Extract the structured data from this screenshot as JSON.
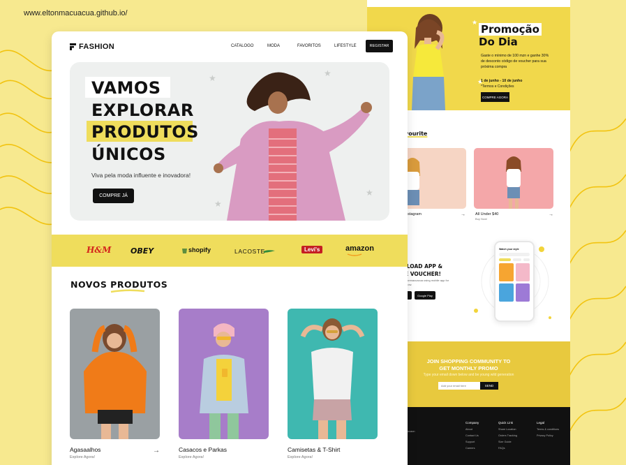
{
  "site_url": "www.eltonmacuacua.github.io/",
  "front": {
    "brand": "FASHION",
    "nav": {
      "catalogo": "CATALOGO",
      "moda": "MODA",
      "favoritos": "FAVORITOS",
      "lifestyle": "LIFESTYLE",
      "register": "REGISTAR"
    },
    "hero": {
      "line1": "VAMOS",
      "line2": "EXPLORAR",
      "line3": "PRODUTOS",
      "line4": "ÚNICOS",
      "subtitle": "Viva pela moda influente e inovadora!",
      "cta": "COMPRE JÁ"
    },
    "brands": [
      "H&M",
      "OBEY",
      "shopify",
      "LACOSTE",
      "Levi's",
      "amazon"
    ],
    "section_title": "NOVOS PRODUTOS",
    "products": [
      {
        "name": "Agasaalhos",
        "sub": "Explore Agora!"
      },
      {
        "name": "Casacos e Parkas",
        "sub": "Explore Agora!"
      },
      {
        "name": "Camisetas & T-Shirt",
        "sub": "Explore Agora!"
      }
    ]
  },
  "back": {
    "promo": {
      "title_line1": "Promoção",
      "title_line2": "Do Dia",
      "text": "Gaste o mínimo de 100 mzn e ganhe 30% de desconto código de voucher para sua próxima compra",
      "dates": "1 de junho - 10 de junho",
      "terms": "*Termos e Condições",
      "cta": "COMPRE AGORA"
    },
    "favourite_title": "vourite",
    "favourites": [
      {
        "caption": "nstagram",
        "sub": ""
      },
      {
        "caption": "All Under $40",
        "sub": "Buy Now!"
      }
    ],
    "app": {
      "title_line1": "ILOAD APP &",
      "title_line2": "E VOUCHER!",
      "desc": "tonmacuacua using mobile app for now.",
      "google_play": "Google Play",
      "phone_header": "Watch your style"
    },
    "community": {
      "title_line1": "JOIN SHOPPING COMMUNITY TO",
      "title_line2": "GET MONTHLY PROMO",
      "subtitle": "Type your email down below and be young wild generation",
      "placeholder": "Add your email here",
      "send": "SEND"
    },
    "footer": {
      "left": "oncaon",
      "company": {
        "title": "Company",
        "items": [
          "About",
          "Contact Us",
          "Support",
          "Careers"
        ]
      },
      "quick": {
        "title": "Quick Link",
        "items": [
          "Share Location",
          "Orders Tracking",
          "Size Guide",
          "FAQs"
        ]
      },
      "legal": {
        "title": "Legal",
        "items": [
          "Terms & conditions",
          "Privacy Policy"
        ]
      }
    }
  },
  "colors": {
    "accent": "#efdd5c",
    "dark": "#111111",
    "hero_bg": "#eef0ef"
  }
}
